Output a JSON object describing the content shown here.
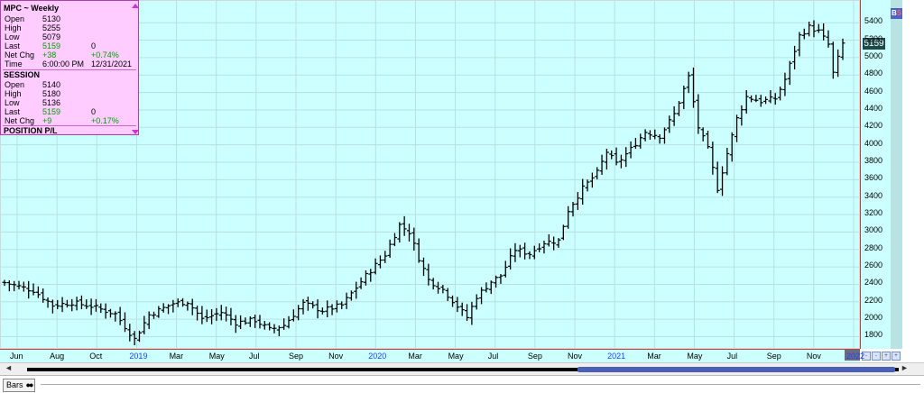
{
  "info_panel": {
    "title": "MPC ~ Weekly",
    "weekly": [
      {
        "label": "Open",
        "value": "5130",
        "extra": ""
      },
      {
        "label": "High",
        "value": "5255",
        "extra": ""
      },
      {
        "label": "Low",
        "value": "5079",
        "extra": ""
      },
      {
        "label": "Last",
        "value": "5159",
        "extra": "0"
      },
      {
        "label": "Net Chg",
        "value": "+38",
        "extra": "+0.74%"
      },
      {
        "label": "Time",
        "value": "6:00:00 PM",
        "extra": "12/31/2021"
      }
    ],
    "session_title": "SESSION",
    "session": [
      {
        "label": "Open",
        "value": "5140",
        "extra": ""
      },
      {
        "label": "High",
        "value": "5180",
        "extra": ""
      },
      {
        "label": "Low",
        "value": "5136",
        "extra": ""
      },
      {
        "label": "Last",
        "value": "5159",
        "extra": "0"
      },
      {
        "label": "Net Chg",
        "value": "+9",
        "extra": "+0.17%"
      }
    ],
    "position_title": "POSITION P/L"
  },
  "last_price_tag": "5159",
  "bs_label": {
    "b": "B",
    "s": "S"
  },
  "bottom_tab": {
    "label": "Bars",
    "dots": "●●"
  },
  "zoom_buttons": [
    "-",
    "-",
    "+",
    "+"
  ],
  "scroll": {
    "left": "◄",
    "right": "►"
  },
  "chart_data": {
    "type": "ohlc",
    "title": "MPC ~ Weekly",
    "ylim": [
      1650,
      5650
    ],
    "y_ticks": [
      1800,
      2000,
      2200,
      2400,
      2600,
      2800,
      3000,
      3200,
      3400,
      3600,
      3800,
      4000,
      4200,
      4400,
      4600,
      4800,
      5000,
      5200,
      5400
    ],
    "x_labels": [
      {
        "label": "Jun",
        "year": false
      },
      {
        "label": "Aug",
        "year": false
      },
      {
        "label": "Oct",
        "year": false
      },
      {
        "label": "2019",
        "year": true
      },
      {
        "label": "Mar",
        "year": false
      },
      {
        "label": "May",
        "year": false
      },
      {
        "label": "Jul",
        "year": false
      },
      {
        "label": "Sep",
        "year": false
      },
      {
        "label": "Nov",
        "year": false
      },
      {
        "label": "2020",
        "year": true
      },
      {
        "label": "Mar",
        "year": false
      },
      {
        "label": "May",
        "year": false
      },
      {
        "label": "Jul",
        "year": false
      },
      {
        "label": "Sep",
        "year": false
      },
      {
        "label": "Nov",
        "year": false
      },
      {
        "label": "2021",
        "year": true
      },
      {
        "label": "Mar",
        "year": false
      },
      {
        "label": "May",
        "year": false
      },
      {
        "label": "Jul",
        "year": false
      },
      {
        "label": "Sep",
        "year": false
      },
      {
        "label": "Nov",
        "year": false
      },
      {
        "label": "2022",
        "year": true
      }
    ],
    "close_anchors": [
      [
        0,
        2420
      ],
      [
        6,
        2330
      ],
      [
        10,
        2160
      ],
      [
        14,
        2190
      ],
      [
        18,
        2150
      ],
      [
        23,
        2060
      ],
      [
        27,
        1770
      ],
      [
        30,
        2050
      ],
      [
        35,
        2180
      ],
      [
        38,
        2200
      ],
      [
        41,
        2000
      ],
      [
        45,
        2080
      ],
      [
        48,
        1960
      ],
      [
        52,
        1990
      ],
      [
        55,
        1880
      ],
      [
        58,
        1930
      ],
      [
        62,
        2180
      ],
      [
        66,
        2100
      ],
      [
        70,
        2160
      ],
      [
        75,
        2500
      ],
      [
        79,
        2740
      ],
      [
        82,
        3080
      ],
      [
        84,
        3000
      ],
      [
        86,
        2700
      ],
      [
        88,
        2450
      ],
      [
        91,
        2340
      ],
      [
        94,
        2150
      ],
      [
        96,
        2020
      ],
      [
        98,
        2260
      ],
      [
        101,
        2430
      ],
      [
        103,
        2500
      ],
      [
        106,
        2800
      ],
      [
        109,
        2750
      ],
      [
        112,
        2880
      ],
      [
        115,
        2900
      ],
      [
        117,
        3250
      ],
      [
        120,
        3500
      ],
      [
        123,
        3680
      ],
      [
        125,
        3920
      ],
      [
        127,
        3780
      ],
      [
        130,
        3950
      ],
      [
        133,
        4150
      ],
      [
        136,
        4100
      ],
      [
        139,
        4350
      ],
      [
        142,
        4780
      ],
      [
        144,
        4200
      ],
      [
        146,
        3950
      ],
      [
        148,
        3500
      ],
      [
        150,
        3900
      ],
      [
        152,
        4300
      ],
      [
        154,
        4550
      ],
      [
        157,
        4500
      ],
      [
        160,
        4530
      ],
      [
        162,
        4750
      ],
      [
        165,
        5250
      ],
      [
        167,
        5350
      ],
      [
        169,
        5300
      ],
      [
        171,
        5150
      ],
      [
        172,
        4820
      ],
      [
        174,
        5159
      ]
    ]
  }
}
